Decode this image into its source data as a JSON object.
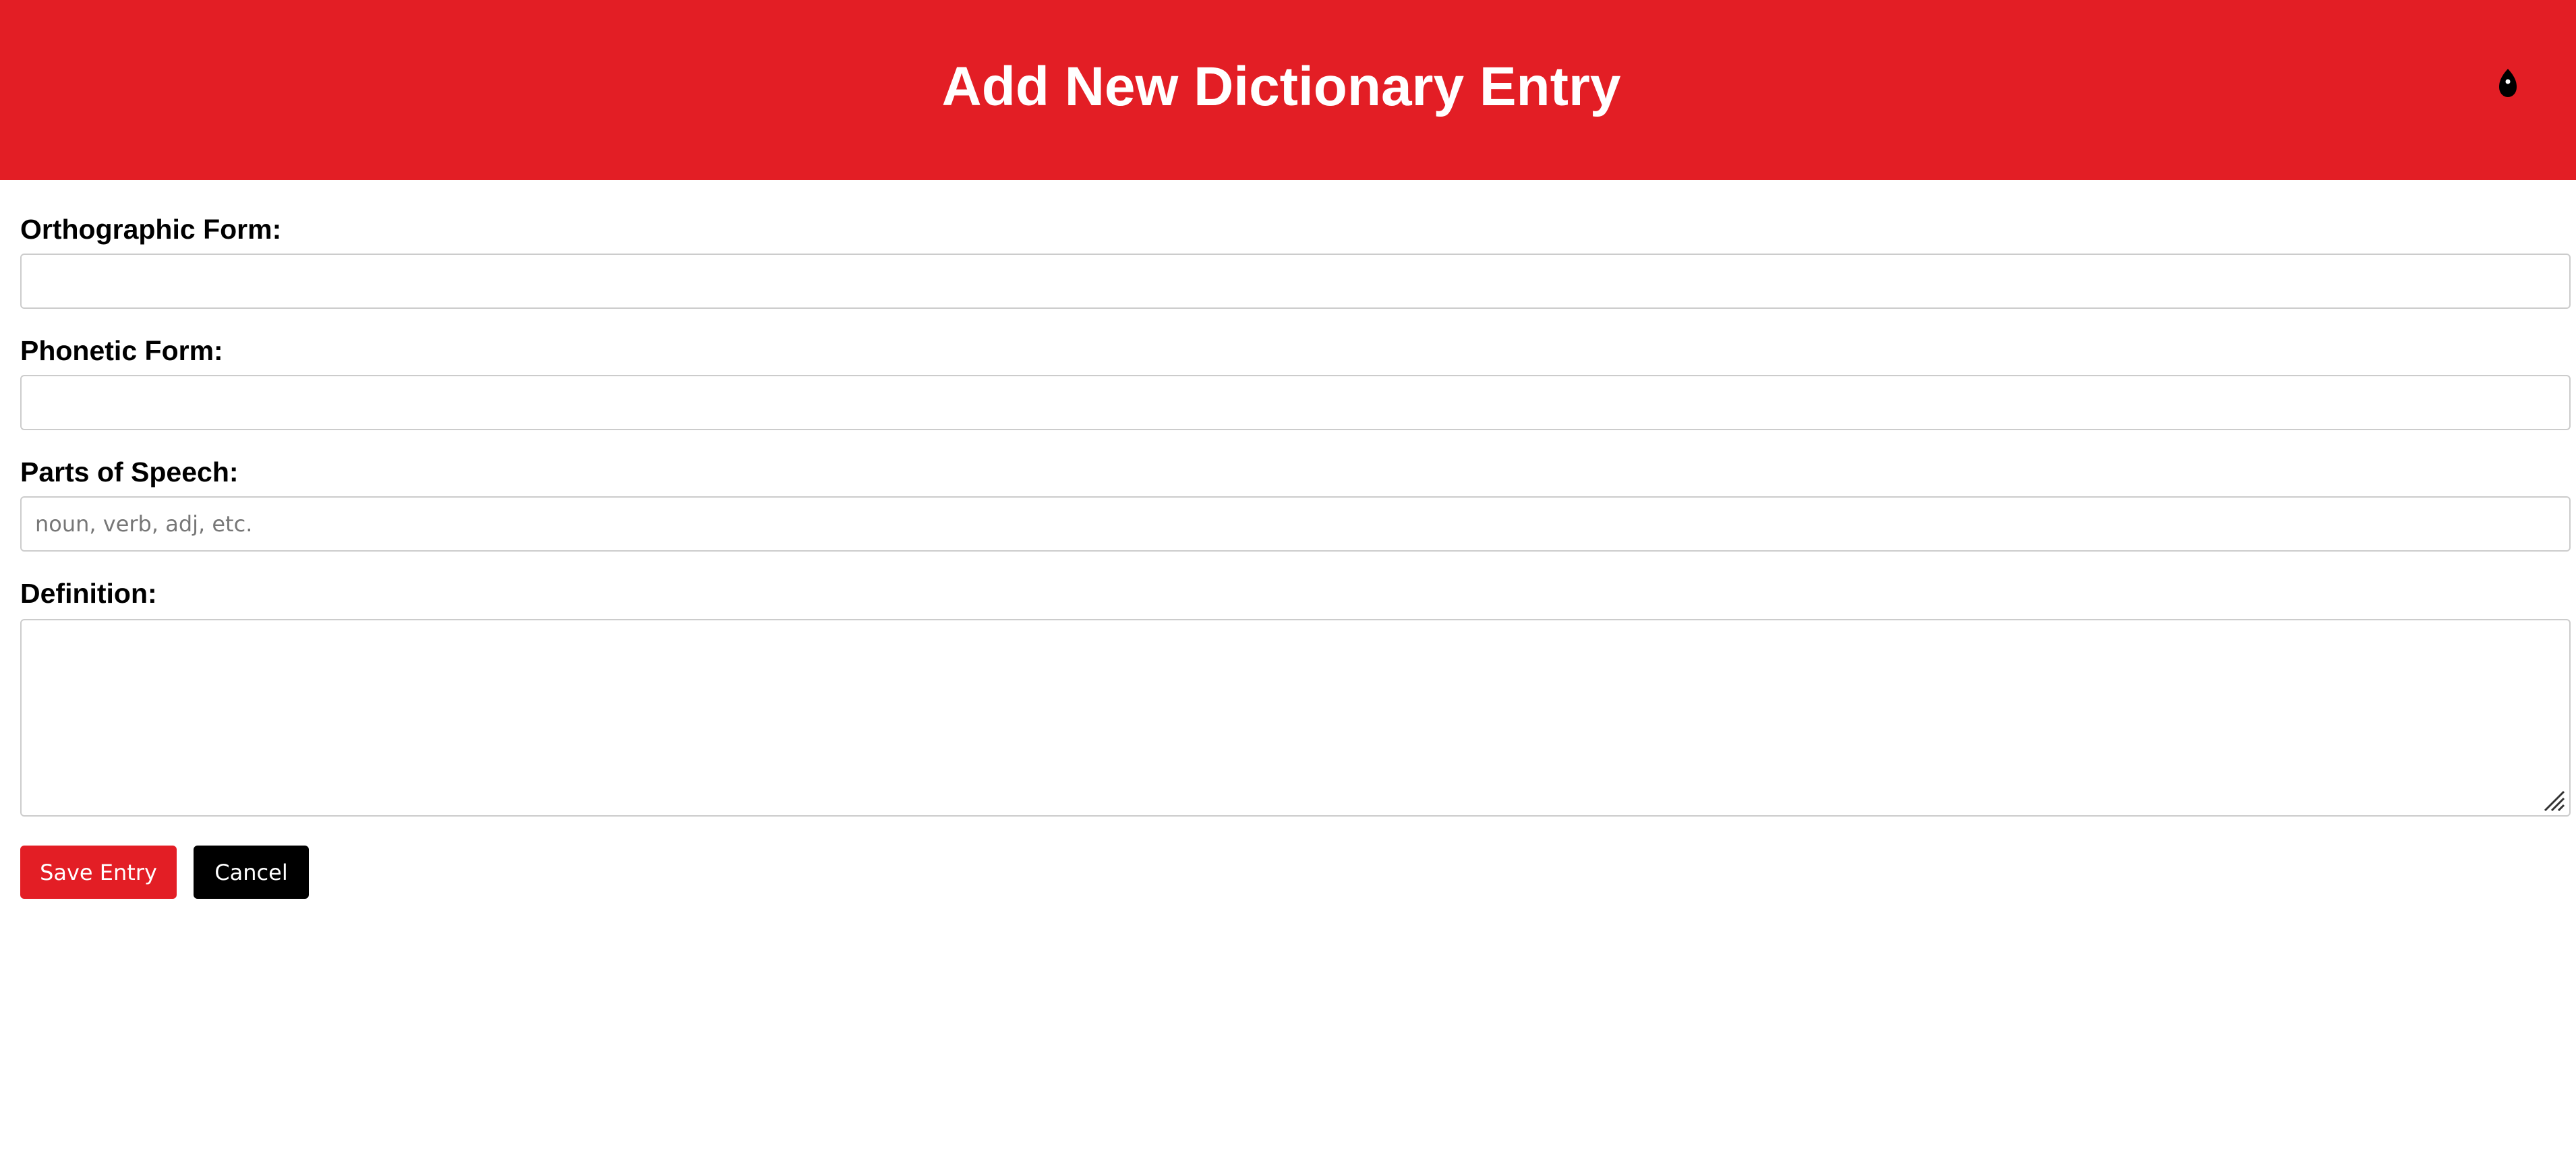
{
  "header": {
    "title": "Add New Dictionary Entry",
    "background_color": "#e31e25",
    "icon": "theme-toggle-icon"
  },
  "form": {
    "orthographic": {
      "label": "Orthographic Form:",
      "value": "",
      "placeholder": ""
    },
    "phonetic": {
      "label": "Phonetic Form:",
      "value": "",
      "placeholder": ""
    },
    "parts_of_speech": {
      "label": "Parts of Speech:",
      "value": "",
      "placeholder": "noun, verb, adj, etc."
    },
    "definition": {
      "label": "Definition:",
      "value": "",
      "placeholder": ""
    }
  },
  "actions": {
    "save_label": "Save Entry",
    "cancel_label": "Cancel",
    "save_color": "#e31e25",
    "cancel_color": "#000000"
  }
}
